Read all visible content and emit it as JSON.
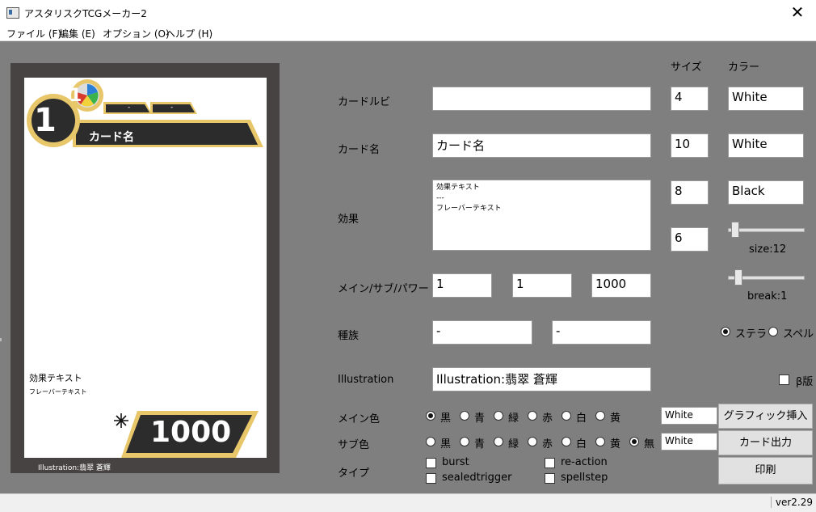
{
  "window": {
    "title": "アスタリスクTCGメーカー2",
    "close": "✕"
  },
  "menu": [
    "ファイル (F)",
    "編集 (E)",
    "オプション (O)",
    "ヘルプ (H)"
  ],
  "headers": {
    "size": "サイズ",
    "color": "カラー"
  },
  "card": {
    "cost": "1",
    "sub": "1",
    "dash1": "-",
    "dash2": "-",
    "name": "カード名",
    "effect": "効果テキスト",
    "flavor": "フレーバーテキスト",
    "power": "1000",
    "illustration": "Illustration:翡翠 蒼輝"
  },
  "form": {
    "ruby": {
      "label": "カードルビ",
      "value": "",
      "size": "4",
      "color": "White"
    },
    "name": {
      "label": "カード名",
      "value": "カード名",
      "size": "10",
      "color": "White"
    },
    "effect": {
      "label": "効果",
      "lines": [
        "効果テキスト",
        "---",
        "フレーバーテキスト"
      ],
      "size1": "8",
      "color": "Black",
      "size2": "6"
    },
    "power": {
      "label": "メイン/サブ/パワー",
      "main": "1",
      "sub": "1",
      "power": "1000"
    },
    "tribe": {
      "label": "種族",
      "a": "-",
      "b": "-"
    },
    "illustration": {
      "label": "Illustration",
      "value": "Illustration:翡翠 蒼輝"
    },
    "main_color": {
      "label": "メイン色",
      "options": [
        "黒",
        "青",
        "緑",
        "赤",
        "白",
        "黄"
      ],
      "selected": 0,
      "color": "White"
    },
    "sub_color": {
      "label": "サブ色",
      "options": [
        "黒",
        "青",
        "緑",
        "赤",
        "白",
        "黄",
        "無"
      ],
      "selected": 6,
      "color": "White"
    },
    "type": {
      "label": "タイプ",
      "options": [
        "burst",
        "re-action",
        "sealedtrigger",
        "spellstep"
      ]
    }
  },
  "sliders": {
    "size_label": "size:12",
    "size_level": 0.05,
    "break_label": "break:1",
    "break_level": 0.1
  },
  "kind": {
    "options": [
      "ステラ",
      "スペル"
    ],
    "selected": 0
  },
  "beta": "β版",
  "buttons": {
    "insert": "グラフィック挿入",
    "export": "カード出力",
    "print": "印刷"
  },
  "status": {
    "version": "ver2.29"
  },
  "colors": {
    "gold": "#e8c66a",
    "dark": "#2c2c2c",
    "frame": "#474343",
    "bg": "#7f7f7f"
  },
  "icons": {
    "sparkle": "sparkle-icon",
    "app": "app-icon"
  }
}
